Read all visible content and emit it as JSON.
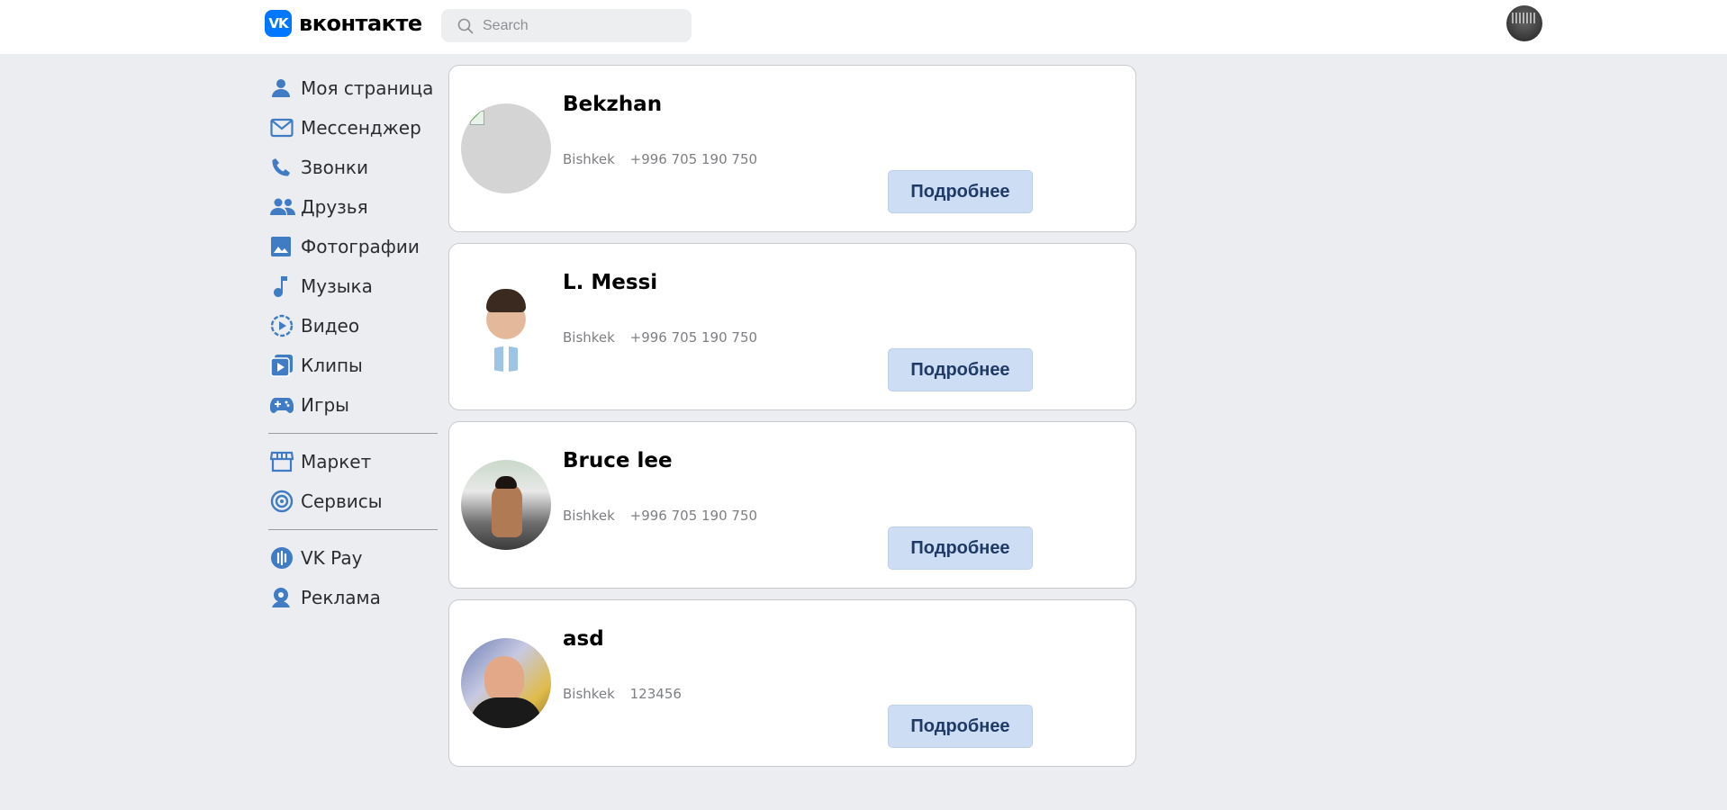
{
  "header": {
    "logo_mark": "VK",
    "logo_text": "вконтакте",
    "search_placeholder": "Search"
  },
  "sidebar": {
    "items": [
      {
        "label": "Моя страница",
        "icon": "user-icon"
      },
      {
        "label": "Мессенджер",
        "icon": "mail-icon"
      },
      {
        "label": "Звонки",
        "icon": "phone-icon"
      },
      {
        "label": "Друзья",
        "icon": "friends-icon"
      },
      {
        "label": "Фотографии",
        "icon": "photo-icon"
      },
      {
        "label": "Музыка",
        "icon": "music-icon"
      },
      {
        "label": "Видео",
        "icon": "video-icon"
      },
      {
        "label": "Клипы",
        "icon": "clips-icon"
      },
      {
        "label": "Игры",
        "icon": "gamepad-icon"
      },
      {
        "label": "Маркет",
        "icon": "market-icon"
      },
      {
        "label": "Сервисы",
        "icon": "services-icon"
      },
      {
        "label": "VK Pay",
        "icon": "vkpay-icon"
      },
      {
        "label": "Реклама",
        "icon": "ads-icon"
      }
    ]
  },
  "contacts": [
    {
      "name": "Bekzhan",
      "city": "Bishkek",
      "phone": "+996 705 190 750",
      "button": "Подробнее"
    },
    {
      "name": "L. Messi",
      "city": "Bishkek",
      "phone": "+996 705 190 750",
      "button": "Подробнее"
    },
    {
      "name": "Bruce lee",
      "city": "Bishkek",
      "phone": "+996 705 190 750",
      "button": "Подробнее"
    },
    {
      "name": "asd",
      "city": "Bishkek",
      "phone": "123456",
      "button": "Подробнее"
    }
  ],
  "colors": {
    "accent": "#0077ff",
    "icon": "#3f7cc4",
    "background": "#ebedf0",
    "button_bg": "#cddef4",
    "button_text": "#203a66"
  }
}
